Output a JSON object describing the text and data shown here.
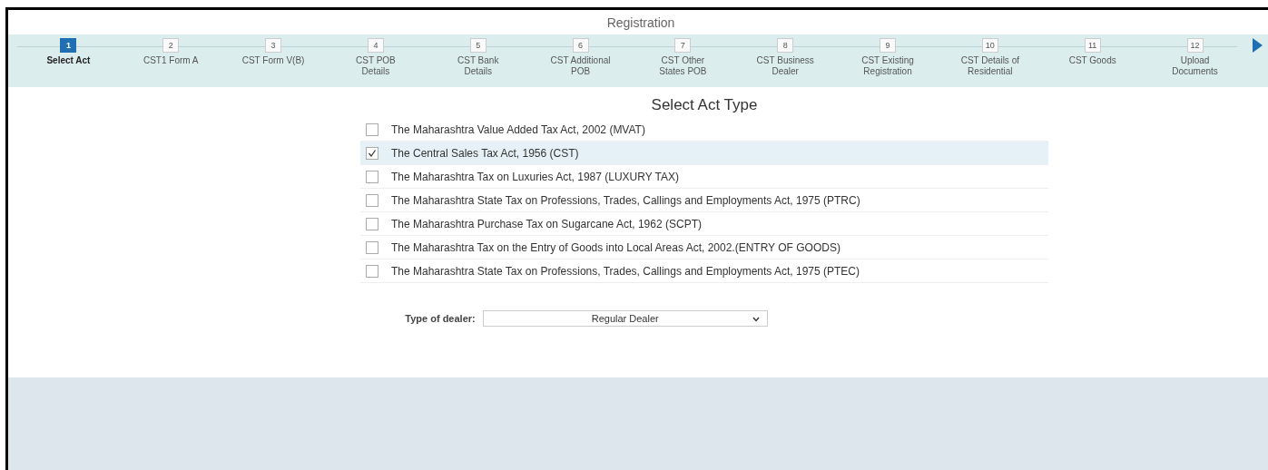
{
  "window": {
    "title": "Registration"
  },
  "steps": [
    {
      "number": "1",
      "label": "Select Act",
      "selected": true
    },
    {
      "number": "2",
      "label": "CST1 Form A",
      "selected": false
    },
    {
      "number": "3",
      "label": "CST Form V(B)",
      "selected": false
    },
    {
      "number": "4",
      "label": "CST POB Details",
      "selected": false
    },
    {
      "number": "5",
      "label": "CST Bank Details",
      "selected": false
    },
    {
      "number": "6",
      "label": "CST Additional POB",
      "selected": false
    },
    {
      "number": "7",
      "label": "CST Other States POB",
      "selected": false
    },
    {
      "number": "8",
      "label": "CST Business Dealer",
      "selected": false
    },
    {
      "number": "9",
      "label": "CST Existing Registration",
      "selected": false
    },
    {
      "number": "10",
      "label": "CST Details of Residential",
      "selected": false
    },
    {
      "number": "11",
      "label": "CST Goods",
      "selected": false
    },
    {
      "number": "12",
      "label": "Upload Documents",
      "selected": false
    }
  ],
  "act_heading": "Select Act Type",
  "acts": [
    {
      "label": "The Maharashtra Value Added Tax Act, 2002 (MVAT)",
      "checked": false
    },
    {
      "label": "The Central Sales Tax Act, 1956 (CST)",
      "checked": true
    },
    {
      "label": "The Maharashtra Tax on Luxuries Act, 1987 (LUXURY TAX)",
      "checked": false
    },
    {
      "label": "The Maharashtra State Tax on Professions, Trades, Callings and Employments Act, 1975 (PTRC)",
      "checked": false
    },
    {
      "label": "The Maharashtra Purchase Tax on Sugarcane Act, 1962 (SCPT)",
      "checked": false
    },
    {
      "label": "The Maharashtra Tax on the Entry of Goods into Local Areas Act, 2002.(ENTRY OF GOODS)",
      "checked": false
    },
    {
      "label": "The Maharashtra State Tax on Professions, Trades, Callings and Employments Act, 1975 (PTEC)",
      "checked": false
    }
  ],
  "dealer": {
    "label": "Type of dealer:",
    "value": "Regular Dealer"
  }
}
